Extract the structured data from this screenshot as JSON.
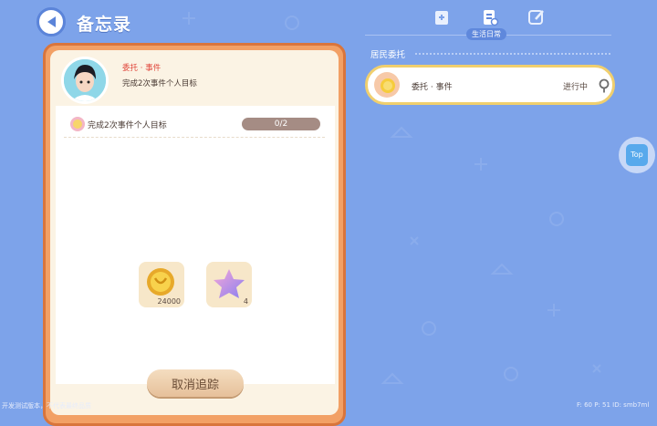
{
  "header": {
    "title": "备忘录"
  },
  "task_detail": {
    "type": "委托 · 事件",
    "description": "完成2次事件个人目标",
    "objective": {
      "text": "完成2次事件个人目标",
      "progress_text": "0/2",
      "progress": 0
    },
    "rewards": [
      {
        "icon": "gold-coin-icon",
        "count": "24000"
      },
      {
        "icon": "star-icon",
        "count": "4"
      }
    ],
    "cancel_label": "取消追踪"
  },
  "tabs": {
    "active_label": "生活日常"
  },
  "resident_section": {
    "label": "居民委托",
    "items": [
      {
        "text": "委托 · 事件",
        "status": "进行中"
      }
    ]
  },
  "top_button": {
    "label": "Top"
  },
  "footer": {
    "left": "开发测试版本，不代表最终品质",
    "right": "F: 60    P: 51    ID: smb7ml"
  },
  "colors": {
    "background": "#7da3ea",
    "card_border": "#d9753c",
    "highlight": "#f0cf6e",
    "accent_red": "#e0453a"
  }
}
